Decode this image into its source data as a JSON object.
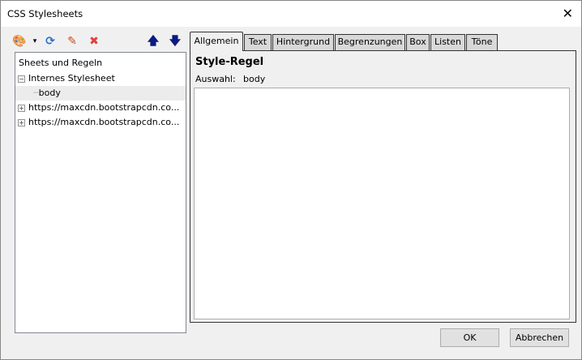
{
  "window": {
    "title": "CSS Stylesheets",
    "close": "✕"
  },
  "toolbar": {
    "palette": "🎨",
    "dropdown": "▾",
    "refresh": "⟳",
    "edit": "✎",
    "delete": "✖",
    "up": "🡅",
    "down": "🡇"
  },
  "tree": {
    "header": "Sheets und Regeln",
    "items": [
      {
        "label": "Internes Stylesheet",
        "expander": "−"
      },
      {
        "label": "body"
      },
      {
        "label": "https://maxcdn.bootstrapcdn.co...",
        "expander": "+"
      },
      {
        "label": "https://maxcdn.bootstrapcdn.co...",
        "expander": "+"
      }
    ]
  },
  "tabs": [
    "Allgemein",
    "Text",
    "Hintergrund",
    "Begrenzungen",
    "Box",
    "Listen",
    "Töne"
  ],
  "panel": {
    "title": "Style-Regel",
    "selector_label": "Auswahl:",
    "selector_value": "body"
  },
  "buttons": {
    "ok": "OK",
    "cancel": "Abbrechen"
  }
}
